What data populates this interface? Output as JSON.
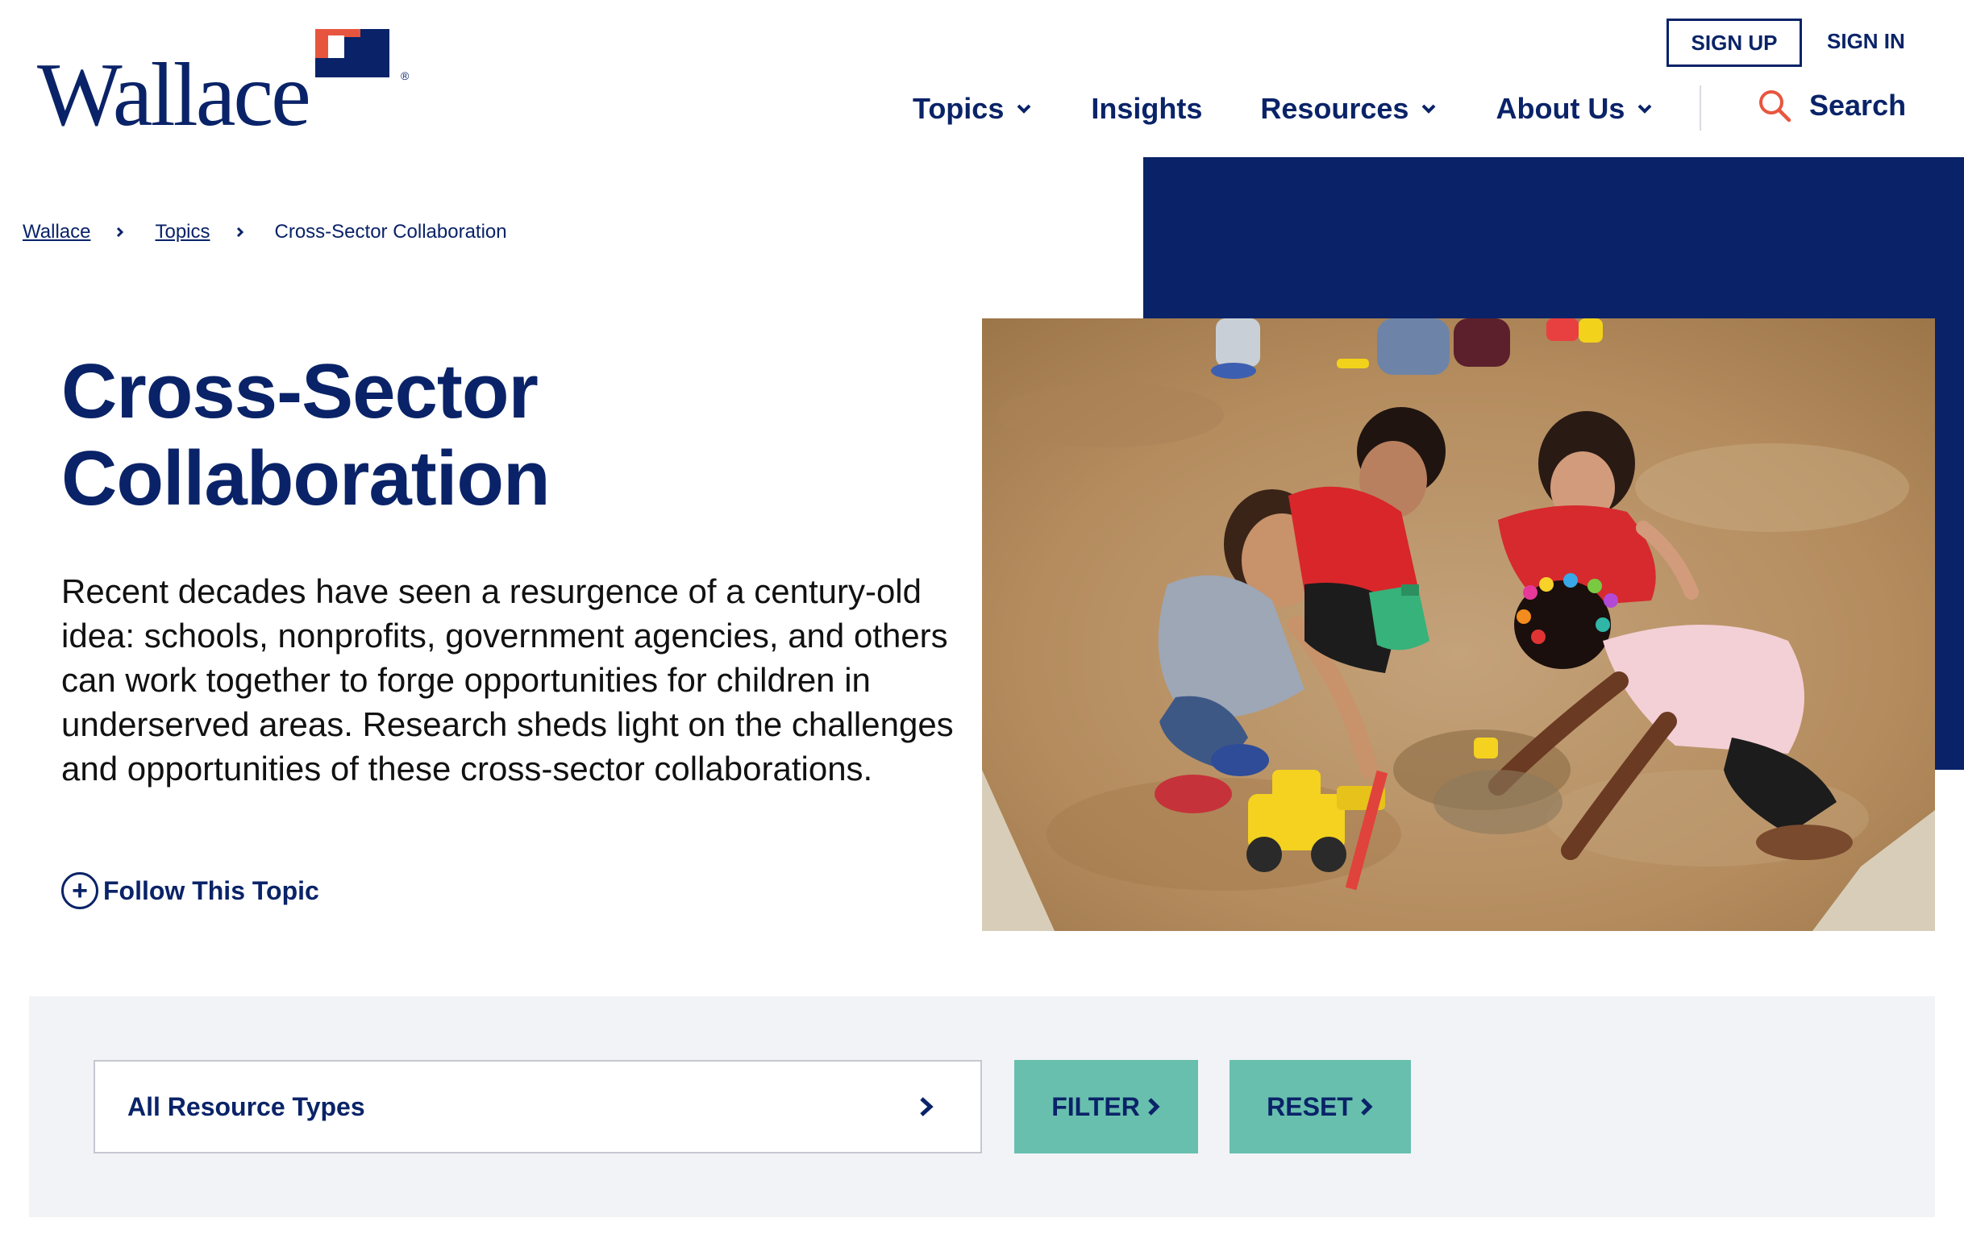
{
  "header": {
    "logo_text": "Wallace",
    "logo_registered": "®",
    "sign_up_label": "SIGN UP",
    "sign_in_label": "SIGN IN",
    "nav": [
      {
        "label": "Topics",
        "has_dropdown": true
      },
      {
        "label": "Insights",
        "has_dropdown": false
      },
      {
        "label": "Resources",
        "has_dropdown": true
      },
      {
        "label": "About Us",
        "has_dropdown": true
      }
    ],
    "search_label": "Search",
    "search_icon": "search-icon"
  },
  "breadcrumb": {
    "items": [
      "Wallace",
      "Topics"
    ],
    "current": "Cross-Sector Collaboration"
  },
  "hero": {
    "title_line1": "Cross-Sector",
    "title_line2": "Collaboration",
    "intro": "Recent decades have seen a resurgence of a century-old idea: schools, nonprofits, government agencies, and others can work together to forge opportunities for children in underserved areas. Research sheds light on the challenges and opportunities of these cross-sector collaborations.",
    "follow_label": "Follow This Topic",
    "follow_icon": "+"
  },
  "filters": {
    "resource_type_selected": "All Resource Types",
    "filter_label": "FILTER",
    "reset_label": "RESET"
  },
  "colors": {
    "brand_navy": "#0a2368",
    "accent_orange": "#e8553f",
    "teal": "#68bfae",
    "panel_gray": "#f2f3f7"
  }
}
